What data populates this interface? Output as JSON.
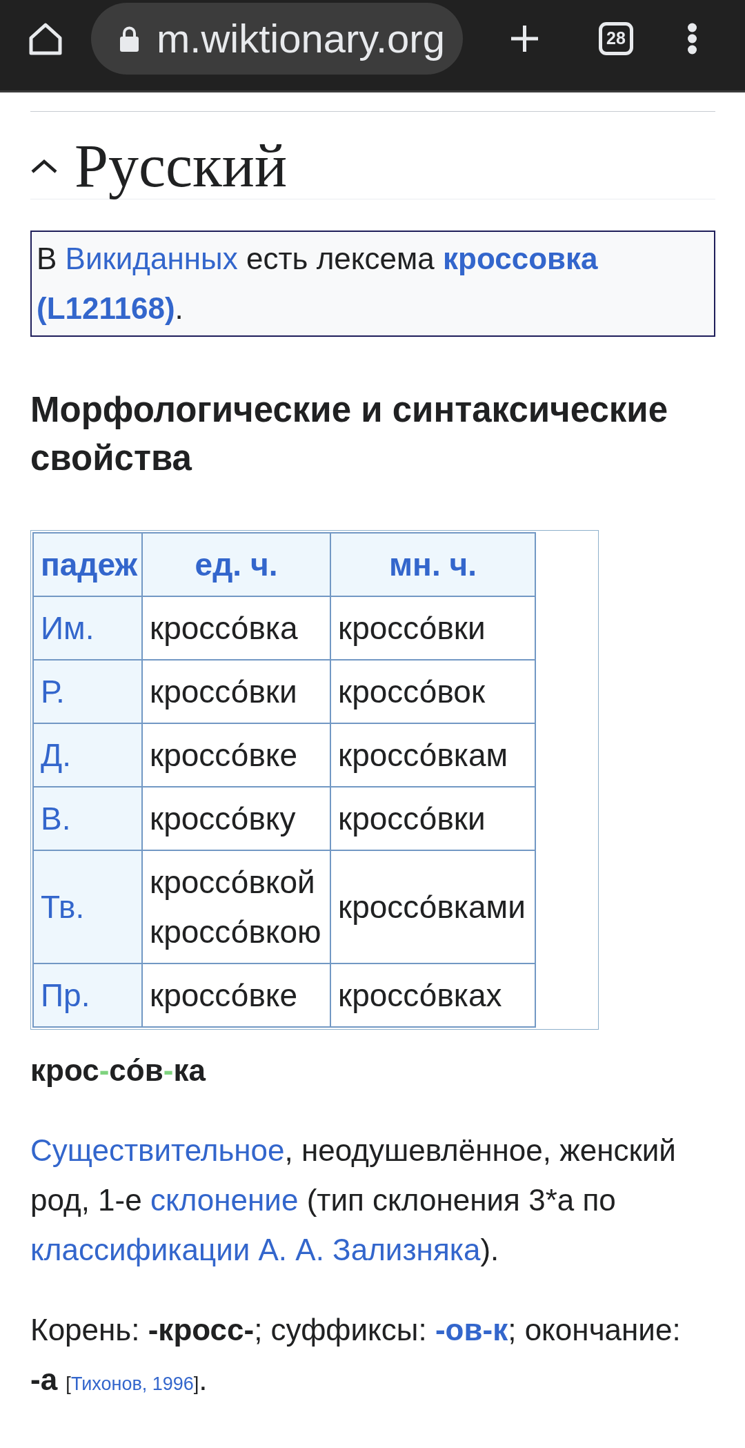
{
  "browser_toolbar": {
    "url": "m.wiktionary.org",
    "tab_count": "28"
  },
  "section": {
    "title": "Русский",
    "expanded": true
  },
  "wikidata_notice": {
    "segments": [
      {
        "kind": "text",
        "text": "В "
      },
      {
        "kind": "link",
        "text": "Викиданных"
      },
      {
        "kind": "text",
        "text": " есть лексема "
      },
      {
        "kind": "bold-link",
        "text": "кроссовка"
      },
      {
        "kind": "space"
      },
      {
        "kind": "bold-link",
        "text": "(L121168)"
      },
      {
        "kind": "text",
        "text": "."
      }
    ]
  },
  "subsection": {
    "title": "Морфологические и синтаксические свойства"
  },
  "inflection_table": {
    "columns": [
      "падеж",
      "ед. ч.",
      "мн. ч."
    ],
    "rows": [
      {
        "case": "Им.",
        "singular": [
          "кроссо́вка"
        ],
        "plural": [
          "кроссо́вки"
        ]
      },
      {
        "case": "Р.",
        "singular": [
          "кроссо́вки"
        ],
        "plural": [
          "кроссо́вок"
        ]
      },
      {
        "case": "Д.",
        "singular": [
          "кроссо́вке"
        ],
        "plural": [
          "кроссо́вкам"
        ]
      },
      {
        "case": "В.",
        "singular": [
          "кроссо́вку"
        ],
        "plural": [
          "кроссо́вки"
        ]
      },
      {
        "case": "Тв.",
        "singular": [
          "кроссо́вкой",
          "кроссо́вкою"
        ],
        "plural": [
          "кроссо́вками"
        ]
      },
      {
        "case": "Пр.",
        "singular": [
          "кроссо́вке"
        ],
        "plural": [
          "кроссо́вках"
        ]
      }
    ]
  },
  "syllabification": [
    {
      "kind": "syllable",
      "text": "крос"
    },
    {
      "kind": "separator",
      "text": "-"
    },
    {
      "kind": "syllable",
      "text": "со́в"
    },
    {
      "kind": "separator",
      "text": "-"
    },
    {
      "kind": "syllable",
      "text": "ка"
    }
  ],
  "paragraphs": [
    {
      "segments": [
        {
          "kind": "link",
          "text": "Существительное"
        },
        {
          "kind": "text",
          "text": ", неодушевлённое, женский род, 1-е "
        },
        {
          "kind": "link",
          "text": "склонение"
        },
        {
          "kind": "text",
          "text": " (тип склонения 3*а по "
        },
        {
          "kind": "link",
          "text": "классификации А. А. Зализняка"
        },
        {
          "kind": "text",
          "text": ")."
        }
      ]
    },
    {
      "segments": [
        {
          "kind": "text",
          "text": "Корень: "
        },
        {
          "kind": "bold",
          "text": "-кросс-"
        },
        {
          "kind": "text",
          "text": "; суффиксы: "
        },
        {
          "kind": "bold-link",
          "text": "-ов-к"
        },
        {
          "kind": "text",
          "text": "; окончание: "
        },
        {
          "kind": "bold",
          "text": "-а"
        },
        {
          "kind": "space"
        },
        {
          "kind": "small",
          "text": "["
        },
        {
          "kind": "small-link",
          "text": "Тихонов, 1996"
        },
        {
          "kind": "small",
          "text": "]"
        },
        {
          "kind": "text",
          "text": "."
        }
      ]
    }
  ]
}
